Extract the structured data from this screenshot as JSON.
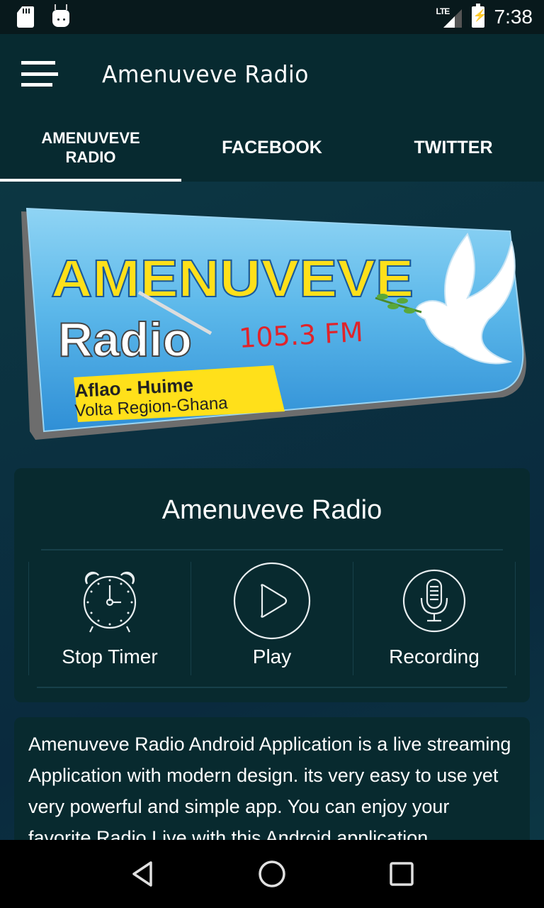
{
  "status_bar": {
    "time": "7:38",
    "network": "LTE",
    "icons": [
      "sd-card-icon",
      "android-debug-icon",
      "lte-signal-icon",
      "battery-charging-icon"
    ]
  },
  "toolbar": {
    "menu_icon": "hamburger-menu-icon",
    "title": "Amenuveve Radio"
  },
  "tabs": [
    {
      "label": "AMENUVEVE RADIO",
      "line1": "AMENUVEVE",
      "line2": "RADIO",
      "active": true
    },
    {
      "label": "FACEBOOK",
      "active": false
    },
    {
      "label": "TWITTER",
      "active": false
    }
  ],
  "banner": {
    "name": "AMENUVEVE",
    "radio": "Radio",
    "frequency": "105.3 FM",
    "location_line1": "Aflao - Huime",
    "location_line2": "Volta Region-Ghana",
    "colors": {
      "sky": "#3fa4e0",
      "yellow": "#ffe01a",
      "red": "#e0242b"
    }
  },
  "player": {
    "station_title": "Amenuveve Radio",
    "controls": [
      {
        "label": "Stop Timer",
        "icon": "alarm-clock-icon"
      },
      {
        "label": "Play",
        "icon": "play-circle-icon"
      },
      {
        "label": "Recording",
        "icon": "microphone-icon"
      }
    ]
  },
  "description": {
    "text": "Amenuveve Radio Android Application is a live streaming Application with modern design. its very easy to use yet very powerful and simple app. You can enjoy your favorite Radio Live with this Android application."
  },
  "nav_bar": {
    "buttons": [
      "back-icon",
      "home-icon",
      "recents-icon"
    ]
  }
}
